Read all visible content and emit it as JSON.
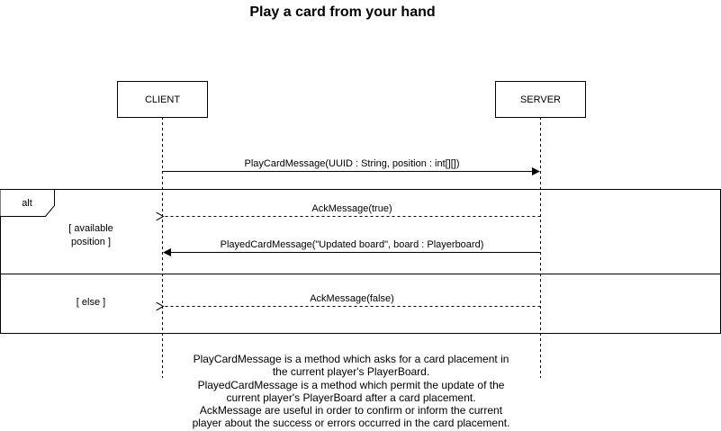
{
  "title": "Play a card from your hand",
  "participants": {
    "client": "CLIENT",
    "server": "SERVER"
  },
  "messages": {
    "play_card": "PlayCardMessage(UUID : String, position : int[][])",
    "ack_true": "AckMessage(true)",
    "played_card": "PlayedCardMessage(\"Updated board\", board : Playerboard)",
    "ack_false": "AckMessage(false)"
  },
  "fragment": {
    "operator": "alt",
    "guard_available_line1": "[ available",
    "guard_available_line2": "position ]",
    "guard_else": "[ else ]"
  },
  "note": {
    "lines": [
      "PlayCardMessage is a method which asks for a card placement in",
      "the current player's PlayerBoard.",
      "PlayedCardMessage is a method which permit the update of the",
      "current player's PlayerBoard after a card placement.",
      "AckMessage are useful in order to confirm or inform the current",
      "player about the success or errors occurred in the card placement."
    ]
  },
  "colors": {
    "stroke": "#000000",
    "background": "#ffffff"
  }
}
